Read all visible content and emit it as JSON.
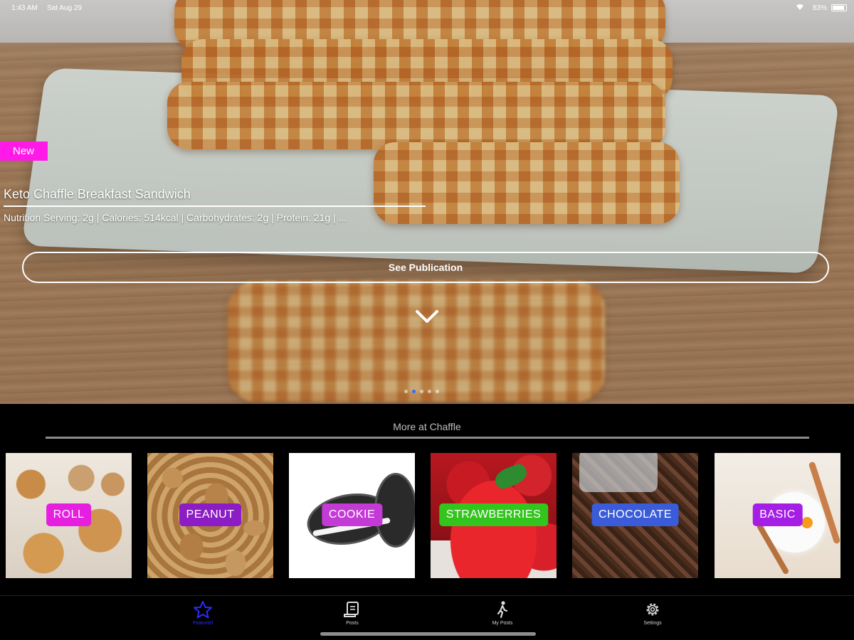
{
  "status_bar": {
    "time": "1:43 AM",
    "date": "Sat Aug 29",
    "battery": "83%"
  },
  "hero": {
    "badge": "New",
    "title": "Keto Chaffle Breakfast Sandwich",
    "nutrition": "Nutrition Serving: 2g | Calories: 514kcal | Carbohydrates: 2g | Protein: 21g | ...",
    "button_label": "See Publication",
    "carousel_pages": 5,
    "carousel_active_index": 1
  },
  "more": {
    "title": "More at Chaffle",
    "categories": [
      {
        "label": "ROLL",
        "color": "#e61ee0"
      },
      {
        "label": "PEANUT",
        "color": "#8c1cc4"
      },
      {
        "label": "COOKIE",
        "color": "#c43ad6"
      },
      {
        "label": "STRAWBERRIES",
        "color": "#34c41e"
      },
      {
        "label": "CHOCOLATE",
        "color": "#3a5cd9"
      },
      {
        "label": "BASIC",
        "color": "#a51ee6"
      }
    ]
  },
  "tabbar": {
    "tabs": [
      {
        "label": "Featured",
        "icon": "star-icon",
        "active": true
      },
      {
        "label": "Posts",
        "icon": "scroll-icon",
        "active": false
      },
      {
        "label": "My Posts",
        "icon": "person-walking-icon",
        "active": false
      },
      {
        "label": "Settings",
        "icon": "gear-icon",
        "active": false
      }
    ]
  },
  "colors": {
    "accent": "#2b2bff",
    "badge_new": "#ff1ae8"
  }
}
